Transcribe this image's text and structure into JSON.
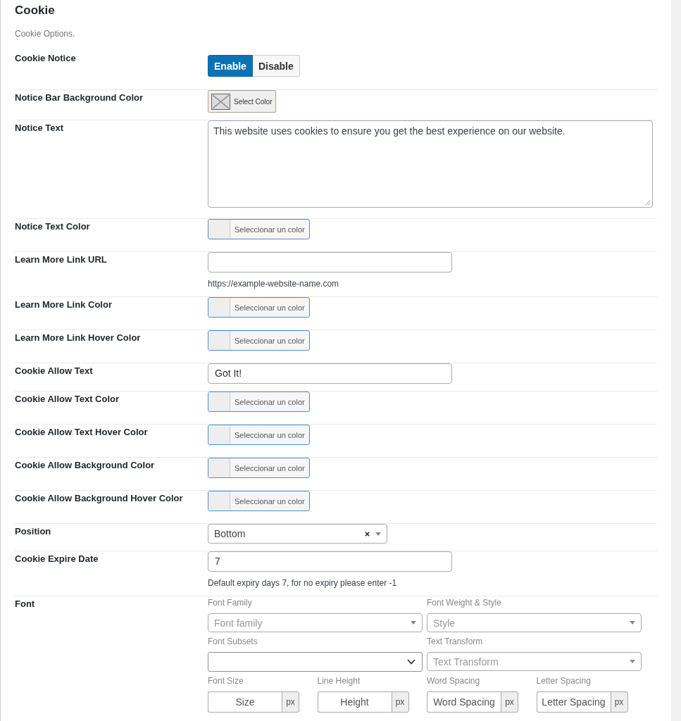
{
  "section": {
    "title": "Cookie",
    "description": "Cookie Options."
  },
  "rows": [
    {
      "kind": "toggle",
      "label": "Cookie Notice",
      "options": [
        {
          "label": "Enable",
          "selected": true
        },
        {
          "label": "Disable",
          "selected": false
        }
      ]
    },
    {
      "kind": "colorbutton",
      "label": "Notice Bar Background Color",
      "button": "Select Color"
    },
    {
      "kind": "textarea",
      "label": "Notice Text",
      "value": "This website uses cookies to ensure you get the best experience on our website."
    },
    {
      "kind": "color",
      "label": "Notice Text Color",
      "button": "Seleccionar un color"
    },
    {
      "kind": "text",
      "label": "Learn More Link URL",
      "description": "https://example-website-name.com"
    },
    {
      "kind": "color",
      "label": "Learn More Link Color",
      "button": "Seleccionar un color"
    },
    {
      "kind": "color",
      "label": "Learn More Link Hover Color",
      "button": "Seleccionar un color"
    },
    {
      "kind": "text",
      "label": "Cookie Allow Text",
      "value": "Got It!"
    },
    {
      "kind": "color",
      "label": "Cookie Allow Text Color",
      "button": "Seleccionar un color"
    },
    {
      "kind": "color",
      "label": "Cookie Allow Text Hover Color",
      "button": "Seleccionar un color"
    },
    {
      "kind": "color",
      "label": "Cookie Allow Background Color",
      "button": "Seleccionar un color"
    },
    {
      "kind": "color",
      "label": "Cookie Allow Background Hover Color",
      "button": "Seleccionar un color"
    },
    {
      "kind": "select",
      "label": "Position",
      "value": "Bottom",
      "clearable": true
    },
    {
      "kind": "text",
      "label": "Cookie Expire Date",
      "value": "7",
      "description": "Default expiry days 7, for no expiry please enter -1"
    },
    {
      "kind": "font",
      "label": "Font",
      "groups": [
        {
          "fields": [
            {
              "kind": "select",
              "label": "Font Family",
              "placeholder": "Font family"
            },
            {
              "kind": "select",
              "label": "Font Weight & Style",
              "placeholder": "Style"
            }
          ]
        },
        {
          "fields": [
            {
              "kind": "native",
              "label": "Font Subsets"
            },
            {
              "kind": "select",
              "label": "Text Transform",
              "placeholder": "Text Transform"
            }
          ]
        },
        {
          "fields": [
            {
              "kind": "unit",
              "label": "Font Size",
              "placeholder": "Size",
              "unit": "px"
            },
            {
              "kind": "unit",
              "label": "Line Height",
              "placeholder": "Height",
              "unit": "px"
            },
            {
              "kind": "unit",
              "label": "Word Spacing",
              "placeholder": "Word Spacing",
              "unit": "px"
            },
            {
              "kind": "unit",
              "label": "Letter Spacing",
              "placeholder": "Letter Spacing",
              "unit": "px"
            }
          ]
        }
      ]
    }
  ]
}
